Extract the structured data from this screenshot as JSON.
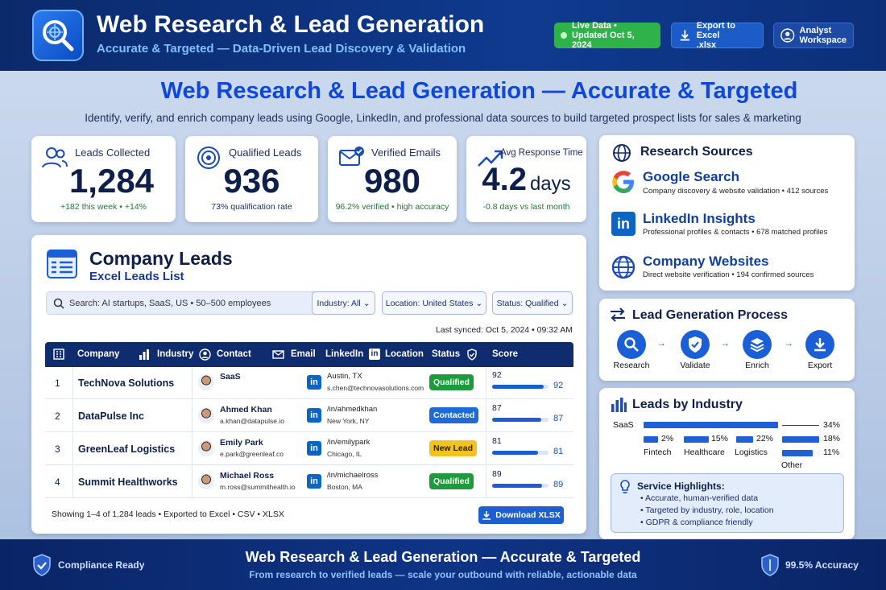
{
  "header": {
    "title": "Web Research & Lead Generation",
    "subtitle": "Accurate & Targeted — Data-Driven Lead Discovery & Validation",
    "live_line1": "Live Data •",
    "live_line2": "Updated Oct 5, 2024",
    "export_line1": "Export to Excel",
    "export_line2": ".xlsx",
    "analyst_line1": "Analyst",
    "analyst_line2": "Workspace"
  },
  "hero": {
    "title": "Web Research & Lead Generation — Accurate & Targeted",
    "subtitle": "Identify, verify, and enrich company leads using Google, LinkedIn, and professional data sources to build targeted prospect lists for sales & marketing"
  },
  "stats": [
    {
      "label": "Leads Collected",
      "value": "1,284",
      "note": "+182 this week • +14%",
      "icon": "users-icon"
    },
    {
      "label": "Qualified Leads",
      "value": "936",
      "note": "73% qualification rate",
      "icon": "target-icon"
    },
    {
      "label": "Verified Emails",
      "value": "980",
      "note": "96.2% verified • high accuracy",
      "icon": "mail-check-icon"
    },
    {
      "label": "Avg Response Time",
      "value": "4.2",
      "unit": "days",
      "note": "-0.8 days vs last month",
      "icon": "trend-up-icon"
    }
  ],
  "leads": {
    "title": "Company Leads",
    "subtitle": "Excel Leads List",
    "search_placeholder": "Search: AI startups, SaaS, US • 50–500 employees",
    "filters": [
      "Industry: All",
      "Location: United States",
      "Status: Qualified"
    ],
    "last_synced": "Last synced: Oct 5, 2024 • 09:32 AM",
    "columns": [
      "Company",
      "Industry",
      "Contact",
      "Email",
      "LinkedIn",
      "Location",
      "Status",
      "Score"
    ],
    "rows": [
      {
        "num": "1",
        "company": "TechNova Solutions",
        "contact": "SaaS",
        "email": "",
        "linkedin": "Austin, TX",
        "location": "s.chen@technovasolutions.com",
        "status": "Qualified",
        "status_color": "#1f9a3a",
        "score": "92",
        "score_pct": 92
      },
      {
        "num": "2",
        "company": "DataPulse Inc",
        "contact": "Ahmed Khan",
        "email": "a.khan@datapulse.io",
        "linkedin": "/in/ahmedkhan",
        "location": "New York, NY",
        "status": "Contacted",
        "status_color": "#1e6bd6",
        "score": "87",
        "score_pct": 87
      },
      {
        "num": "3",
        "company": "GreenLeaf Logistics",
        "contact": "Emily Park",
        "email": "e.park@greenleaf.co",
        "linkedin": "/in/emilypark",
        "location": "Chicago, IL",
        "status": "New Lead",
        "status_color": "#f3c21f",
        "score": "81",
        "score_pct": 81
      },
      {
        "num": "4",
        "company": "Summit Healthworks",
        "contact": "Michael Ross",
        "email": "m.ross@summithealth.io",
        "linkedin": "/in/michaelross",
        "location": "Boston, MA",
        "status": "Qualified",
        "status_color": "#1f9a3a",
        "score": "89",
        "score_pct": 89
      }
    ],
    "showing": "Showing 1–4 of 1,284 leads • Exported to Excel • CSV • XLSX",
    "download_label": "Download XLSX"
  },
  "sources": {
    "title": "Research Sources",
    "items": [
      {
        "name": "Google Search",
        "desc": "Company discovery & website validation • 412 sources",
        "icon": "google-icon"
      },
      {
        "name": "LinkedIn Insights",
        "desc": "Professional profiles & contacts • 678 matched profiles",
        "icon": "linkedin-icon"
      },
      {
        "name": "Company Websites",
        "desc": "Direct website verification • 194 confirmed sources",
        "icon": "globe-icon"
      }
    ]
  },
  "process": {
    "title": "Lead Generation Process",
    "steps": [
      "Research",
      "Validate",
      "Enrich",
      "Export"
    ]
  },
  "industry": {
    "title": "Leads by Industry",
    "saas_label": "SaaS",
    "saas_pct": "34%",
    "small": [
      {
        "label": "Fintech",
        "pct": "2%"
      },
      {
        "label": "Healthcare",
        "pct": "15%"
      },
      {
        "label": "Logistics",
        "pct": "22%"
      }
    ],
    "right_pcts": [
      "18%",
      "11%"
    ],
    "other_label": "Other"
  },
  "highlights": {
    "title": "Service Highlights:",
    "items": [
      "• Accurate, human-verified data",
      "• Targeted by industry, role, location",
      "• GDPR & compliance friendly"
    ]
  },
  "footer": {
    "left": "Compliance Ready",
    "right": "99.5% Accuracy",
    "title": "Web Research & Lead Generation — Accurate & Targeted",
    "subtitle": "From research to verified leads — scale your outbound with reliable, actionable data"
  }
}
